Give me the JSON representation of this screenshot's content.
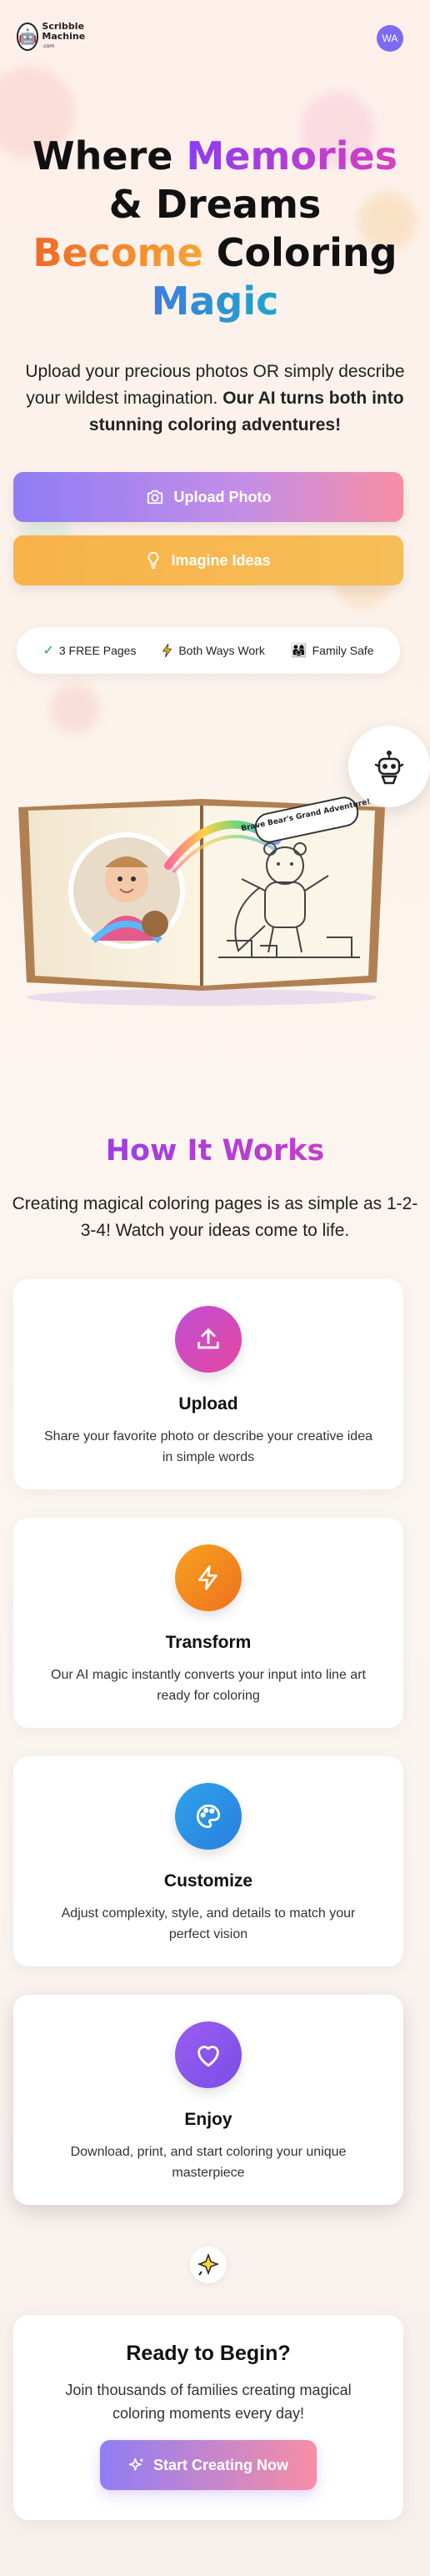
{
  "header": {
    "logo_text": "Scribble Machine",
    "logo_small": ".com",
    "avatar_initials": "WA"
  },
  "hero": {
    "title_part1": "Where ",
    "title_memories": "Memories",
    "title_part2": " & Dreams",
    "title_become": "Become",
    "title_coloring": " Coloring",
    "title_magic": "Magic",
    "subtitle_plain": "Upload your precious photos OR simply describe your wildest imagination. ",
    "subtitle_bold": "Our AI turns both into stunning coloring adventures!",
    "upload_label": "Upload Photo",
    "ideas_label": "Imagine Ideas"
  },
  "features": [
    {
      "icon": "check-icon",
      "label": "3 FREE Pages"
    },
    {
      "icon": "lightning-icon",
      "label": "Both Ways Work"
    },
    {
      "icon": "family-icon",
      "label": "Family Safe"
    }
  ],
  "book": {
    "speech_bubble": "Brave Bear's Grand Adventure!"
  },
  "how": {
    "title": "How It Works",
    "subtitle": "Creating magical coloring pages is as simple as 1-2-3-4! Watch your ideas come to life.",
    "steps": [
      {
        "title": "Upload",
        "text": "Share your favorite photo or describe your creative idea in simple words",
        "icon": "upload-icon",
        "color": "#d04ab6"
      },
      {
        "title": "Transform",
        "text": "Our AI magic instantly converts your input into line art ready for coloring",
        "icon": "lightning-icon",
        "color": "#f0801e"
      },
      {
        "title": "Customize",
        "text": "Adjust complexity, style, and details to match your perfect vision",
        "icon": "palette-icon",
        "color": "#2a93e6"
      },
      {
        "title": "Enjoy",
        "text": "Download, print, and start coloring your unique masterpiece",
        "icon": "heart-icon",
        "color": "#8a56ea"
      }
    ]
  },
  "cta": {
    "title": "Ready to Begin?",
    "text": "Join thousands of families creating magical coloring moments every day!",
    "button_label": "Start Creating Now"
  }
}
